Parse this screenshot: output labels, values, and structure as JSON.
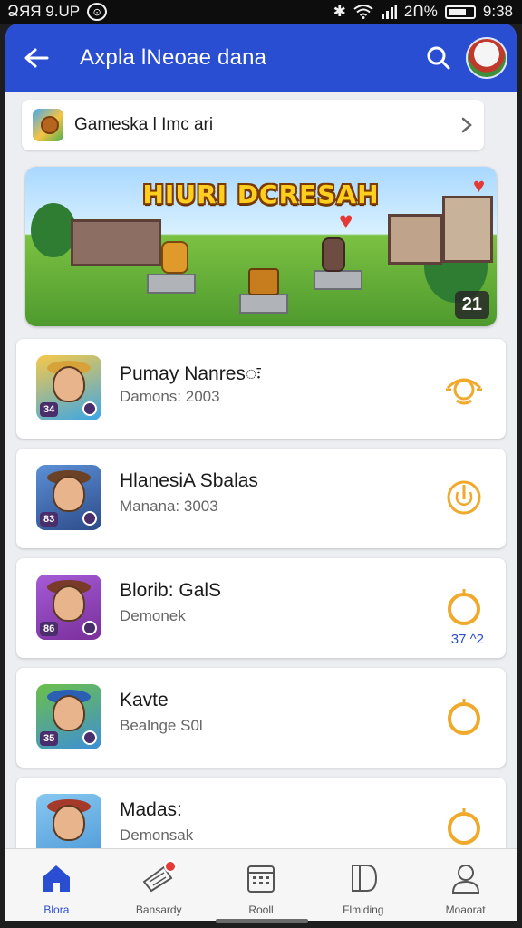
{
  "status_bar": {
    "left_text": "ՁЯЯ 9.UP",
    "percent": "2Ո%",
    "time": "9:38"
  },
  "app_bar": {
    "title": "Axpla lNeoae dana"
  },
  "store_row": {
    "label": "Gameska l Imc ari"
  },
  "banner": {
    "title": "HIURI DCRESAH",
    "counter": "21"
  },
  "games": [
    {
      "name": "Pumay Nanresः",
      "sub": "Damons: 2003",
      "level": "34",
      "extra": "",
      "icon_colors": [
        "#f7c948",
        "#3aa6e8"
      ],
      "hat_color": "#d8a23a",
      "action_icon": "eye-ring-icon"
    },
    {
      "name": "HlanesiA Sbalas",
      "sub": "Manana: 3003",
      "level": "83",
      "extra": "",
      "icon_colors": [
        "#5b8fd6",
        "#2d4c8a"
      ],
      "hat_color": "#6b4226",
      "action_icon": "power-ring-icon"
    },
    {
      "name": "Blorib: GalS",
      "sub": "Demonek",
      "level": "86",
      "extra": "37 ^2",
      "icon_colors": [
        "#a45bd6",
        "#7a2f9a"
      ],
      "hat_color": "#7a3a2a",
      "action_icon": "ring-icon"
    },
    {
      "name": "Kavte",
      "sub": "Bealnge S0l",
      "level": "35",
      "extra": "",
      "icon_colors": [
        "#6cbf4a",
        "#3d8fd6"
      ],
      "hat_color": "#2b5fb3",
      "action_icon": "ring-icon"
    },
    {
      "name": "Madas:",
      "sub": "Demonsak",
      "level": "",
      "extra": "",
      "icon_colors": [
        "#88c8f0",
        "#4e9ad8"
      ],
      "hat_color": "#a63a2a",
      "action_icon": "ring-icon"
    }
  ],
  "nav": [
    {
      "label": "Blora",
      "icon": "home-icon",
      "active": true
    },
    {
      "label": "Bansardy",
      "icon": "ticket-icon",
      "active": false
    },
    {
      "label": "Rooll",
      "icon": "calendar-icon",
      "active": false
    },
    {
      "label": "Flmiding",
      "icon": "book-icon",
      "active": false
    },
    {
      "label": "Moaorat",
      "icon": "profile-icon",
      "active": false
    }
  ],
  "colors": {
    "primary": "#2a4ed2",
    "accent": "#f0a92a",
    "badge": "#e53935"
  }
}
